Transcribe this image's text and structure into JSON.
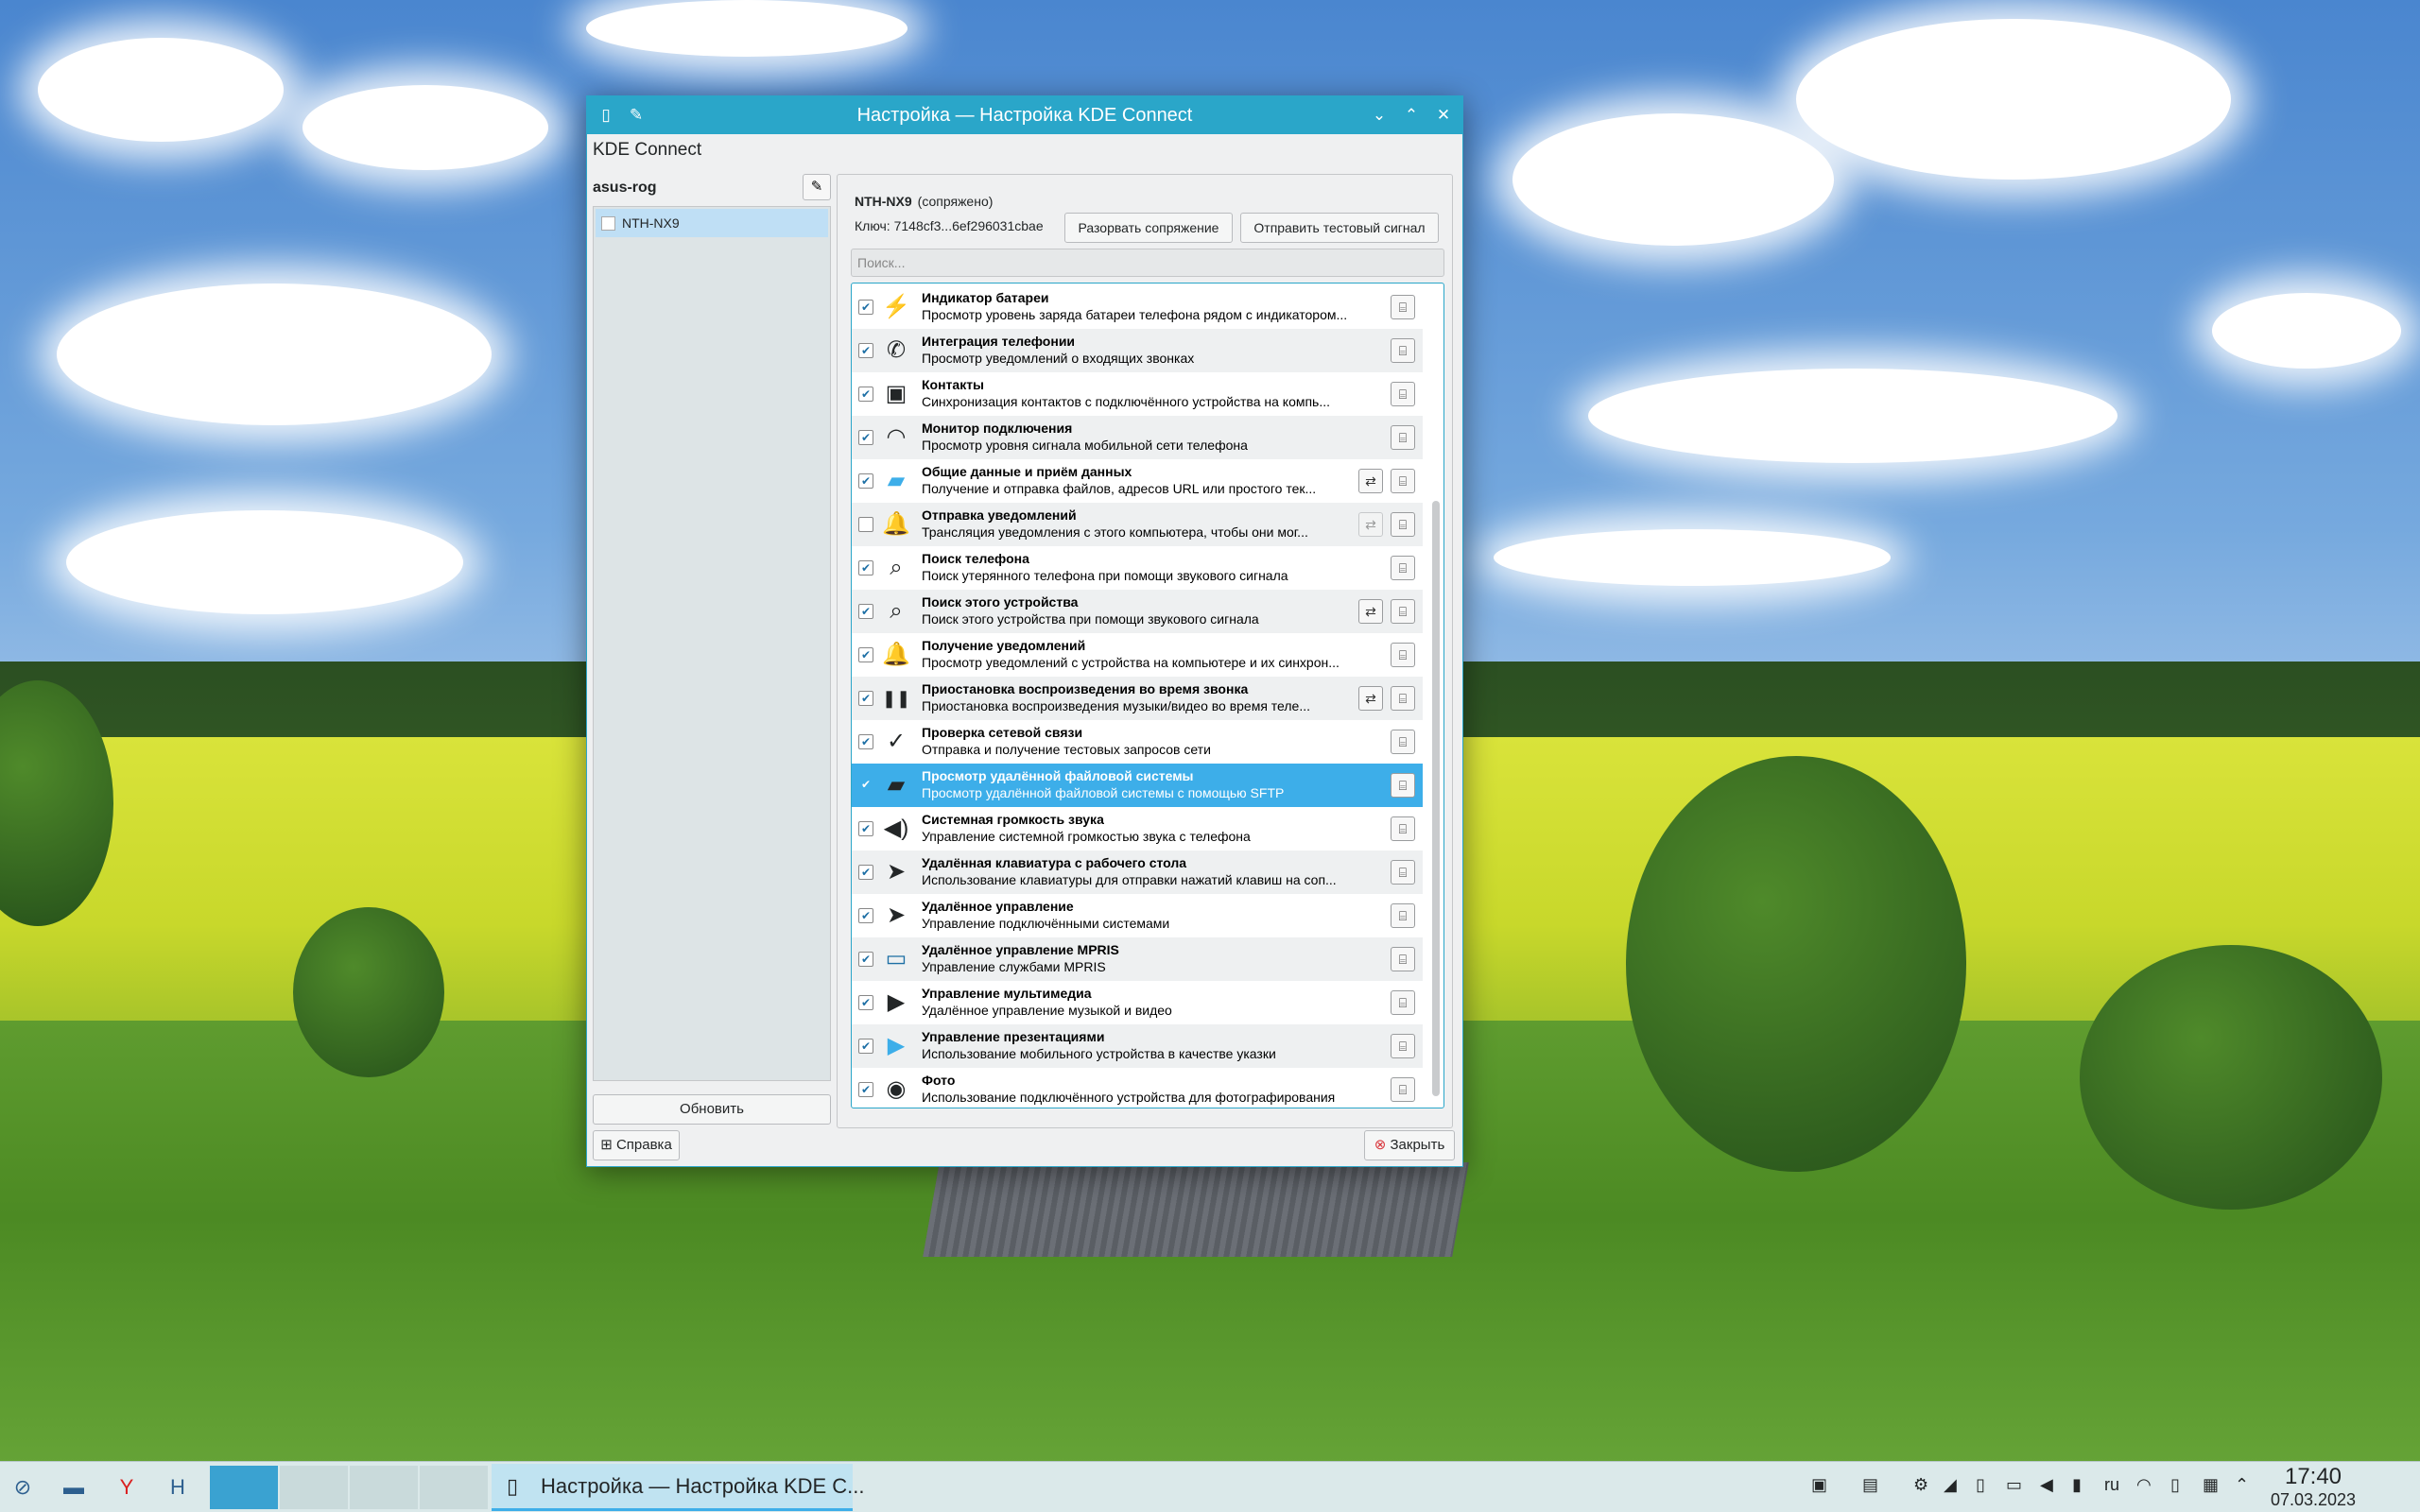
{
  "window": {
    "title": "Настройка — Настройка KDE Connect",
    "app_header": "KDE Connect"
  },
  "left": {
    "host_name": "asus-rog",
    "devices": [
      {
        "name": "NTH-NX9"
      }
    ],
    "refresh_label": "Обновить"
  },
  "device": {
    "name": "NTH-NX9",
    "state": "(сопряжено)",
    "key": "Ключ: 7148cf3...6ef296031cbae",
    "unpair_label": "Разорвать сопряжение",
    "ping_label": "Отправить тестовый сигнал",
    "search_placeholder": "Поиск..."
  },
  "plugins": [
    {
      "title": "Индикатор батареи",
      "desc": "Просмотр уровень заряда батареи телефона рядом с индикатором...",
      "checked": true,
      "icon": "battery-icon",
      "config": false
    },
    {
      "title": "Интеграция телефонии",
      "desc": "Просмотр уведомлений о входящих звонках",
      "checked": true,
      "icon": "phone-icon",
      "config": false
    },
    {
      "title": "Контакты",
      "desc": "Синхронизация контактов с подключённого устройства на компь...",
      "checked": true,
      "icon": "contacts-icon",
      "config": false
    },
    {
      "title": "Монитор подключения",
      "desc": "Просмотр уровня сигнала мобильной сети телефона",
      "checked": true,
      "icon": "wifi-icon",
      "config": false
    },
    {
      "title": "Общие данные и приём данных",
      "desc": "Получение и отправка файлов, адресов URL или простого тек...",
      "checked": true,
      "icon": "folder-share-icon",
      "config": true
    },
    {
      "title": "Отправка уведомлений",
      "desc": "Трансляция уведомления с этого компьютера, чтобы они мог...",
      "checked": false,
      "icon": "bell-icon",
      "config": true
    },
    {
      "title": "Поиск телефона",
      "desc": "Поиск утерянного телефона при помощи звукового сигнала",
      "checked": true,
      "icon": "magnifier-icon",
      "config": false
    },
    {
      "title": "Поиск этого устройства",
      "desc": "Поиск этого устройства при помощи звукового сигнала",
      "checked": true,
      "icon": "magnifier-icon",
      "config": true
    },
    {
      "title": "Получение уведомлений",
      "desc": "Просмотр уведомлений с устройства на компьютере и их синхрон...",
      "checked": true,
      "icon": "bell-icon",
      "config": false
    },
    {
      "title": "Приостановка воспроизведения во время звонка",
      "desc": "Приостановка воспроизведения музыки/видео во время теле...",
      "checked": true,
      "icon": "pause-icon",
      "config": true
    },
    {
      "title": "Проверка сетевой связи",
      "desc": "Отправка и получение тестовых запросов сети",
      "checked": true,
      "icon": "checkmark-icon",
      "config": false
    },
    {
      "title": "Просмотр удалённой файловой системы",
      "desc": "Просмотр удалённой файловой системы с помощью SFTP",
      "checked": true,
      "icon": "folder-remote-icon",
      "config": false
    },
    {
      "title": "Системная громкость звука",
      "desc": "Управление системной громкостью звука с телефона",
      "checked": true,
      "icon": "speaker-icon",
      "config": false
    },
    {
      "title": "Удалённая клавиатура с рабочего стола",
      "desc": "Использование клавиатуры для отправки нажатий клавиш на соп...",
      "checked": true,
      "icon": "pointer-icon",
      "config": false
    },
    {
      "title": "Удалённое управление",
      "desc": "Управление подключёнными системами",
      "checked": true,
      "icon": "pointer-icon",
      "config": false
    },
    {
      "title": "Удалённое управление MPRIS",
      "desc": "Управление службами MPRIS",
      "checked": true,
      "icon": "monitor-icon",
      "config": false
    },
    {
      "title": "Управление мультимедиа",
      "desc": "Удалённое управление музыкой и видео",
      "checked": true,
      "icon": "play-icon",
      "config": false
    },
    {
      "title": "Управление презентациями",
      "desc": "Использование мобильного устройства в качестве указки",
      "checked": true,
      "icon": "presentation-icon",
      "config": false
    },
    {
      "title": "Фото",
      "desc": "Использование подключённого устройства для фотографирования",
      "checked": true,
      "icon": "camera-icon",
      "config": false
    }
  ],
  "selected_plugin_index": 11,
  "footer": {
    "help_label": "Справка",
    "close_label": "Закрыть"
  },
  "taskbar": {
    "task_label": "Настройка — Настройка KDE C...",
    "keyboard_layout": "ru",
    "time": "17:40",
    "date": "07.03.2023"
  }
}
